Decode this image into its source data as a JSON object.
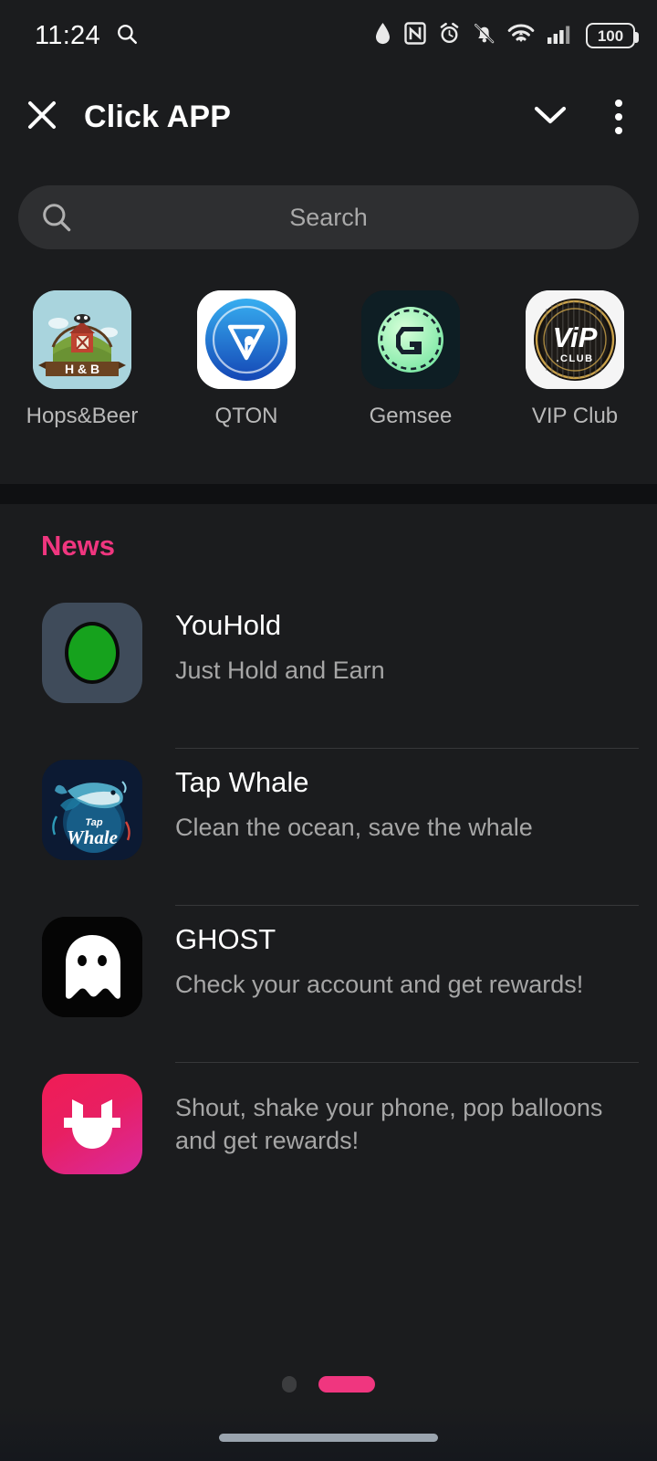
{
  "statusbar": {
    "time": "11:24",
    "search_icon": "search-icon",
    "icons": [
      "water-drop-icon",
      "nfc-icon",
      "alarm-clock-icon",
      "bell-muted-icon",
      "wifi-icon",
      "cellular-signal-icon"
    ],
    "battery_level": "100"
  },
  "appbar": {
    "close_label": "close-icon",
    "title": "Click APP",
    "chevron_label": "chevron-down-icon",
    "more_label": "overflow-menu-icon"
  },
  "search": {
    "placeholder": "Search",
    "value": ""
  },
  "shortcuts": [
    {
      "label": "Hops&Beer",
      "icon": "hops-and-beer-icon",
      "badge": "H & B"
    },
    {
      "label": "QTON",
      "icon": "qton-icon"
    },
    {
      "label": "Gemsee",
      "icon": "gemsee-icon",
      "glyph": "G"
    },
    {
      "label": "VIP Club",
      "icon": "vip-club-icon",
      "badge": "ViP",
      "sub": ".CLUB"
    }
  ],
  "news": {
    "heading": "News",
    "items": [
      {
        "title": "YouHold",
        "desc": "Just Hold and Earn",
        "icon": "youhold-icon"
      },
      {
        "title": "Tap Whale",
        "desc": "Clean the ocean, save the whale",
        "icon": "tap-whale-icon",
        "art_top": "Tap",
        "art_bottom": "Whale"
      },
      {
        "title": "GHOST",
        "desc": "Check your account and get rewards!",
        "icon": "ghost-icon"
      },
      {
        "title": "",
        "desc": "Shout, shake your phone, pop balloons and get rewards!",
        "icon": "horns-icon"
      }
    ]
  },
  "pager": {
    "total": 2,
    "active_index": 1
  },
  "colors": {
    "accent": "#f0367f",
    "background": "#1b1c1e",
    "surface": "#2e2f31",
    "text_primary": "#ffffff",
    "text_secondary": "#a6a6a6"
  }
}
